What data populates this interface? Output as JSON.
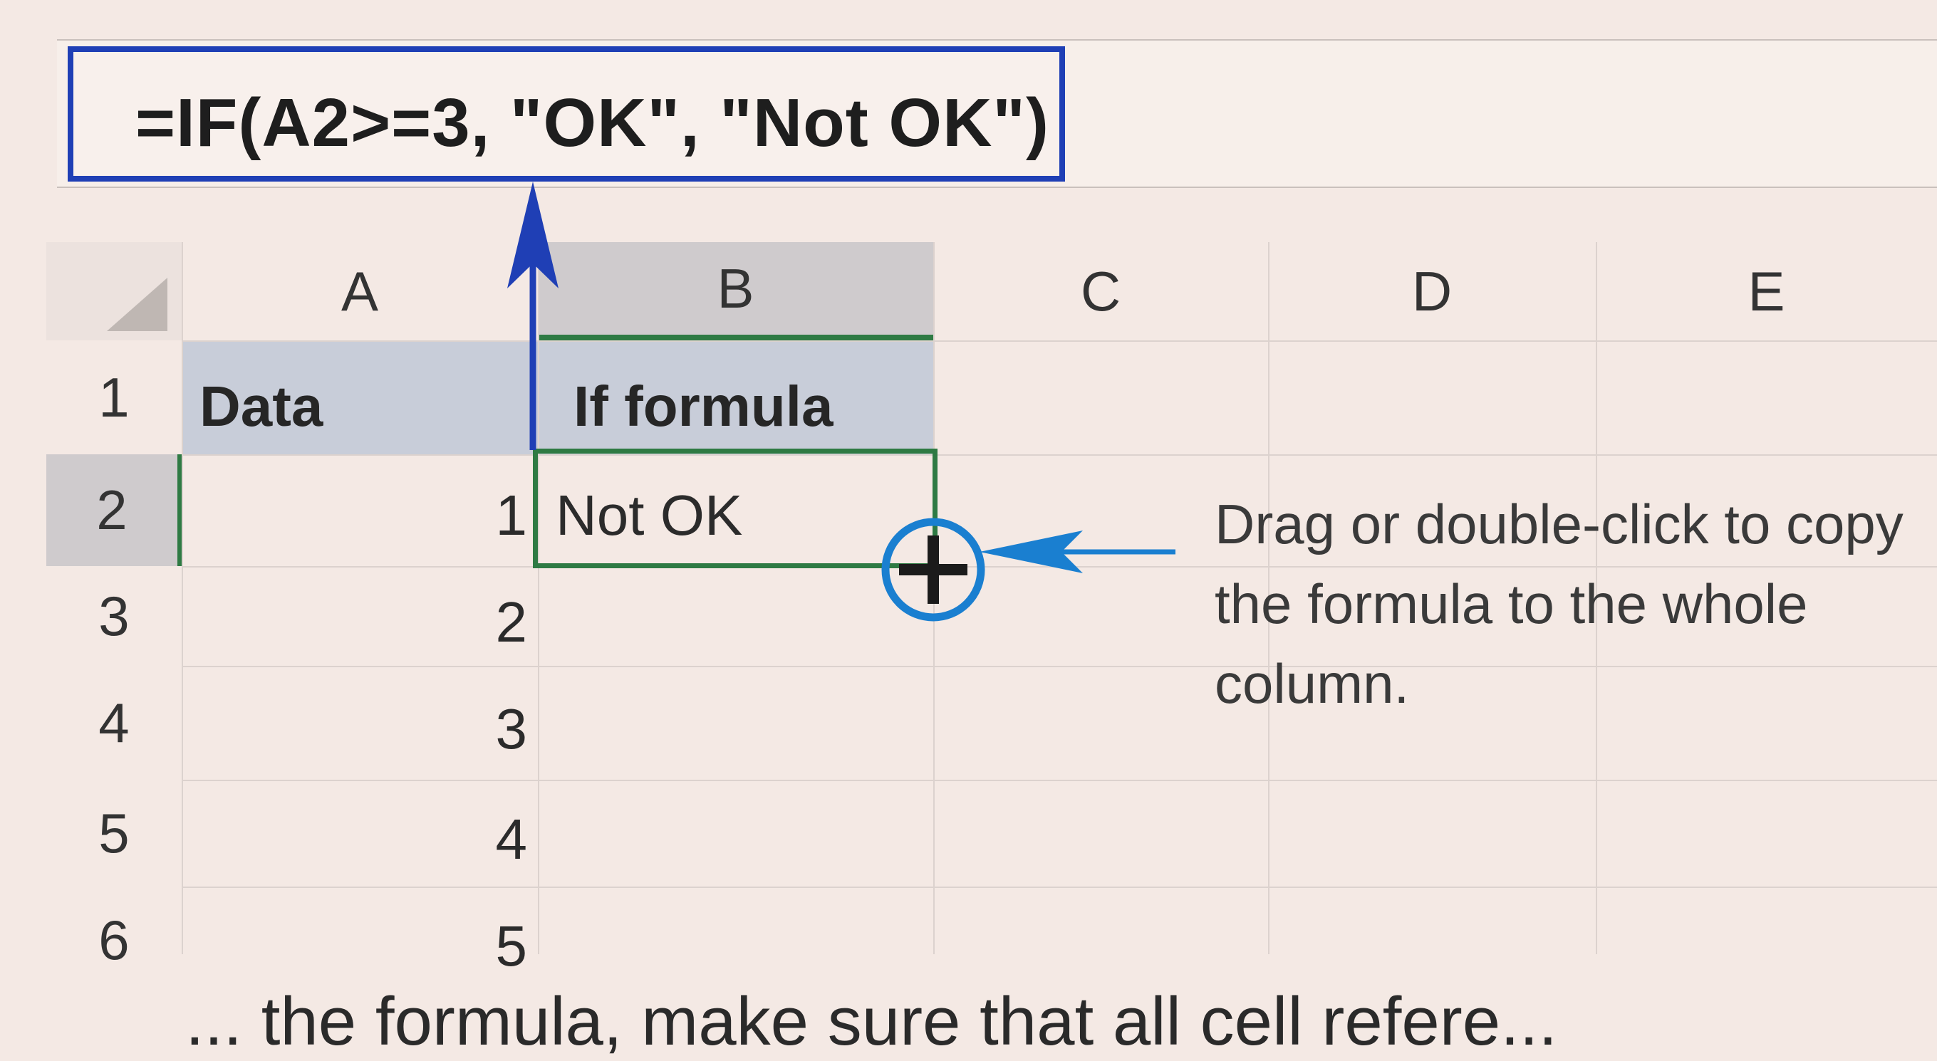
{
  "formula_bar": {
    "formula": "=IF(A2>=3, \"OK\", \"Not OK\")"
  },
  "sheet": {
    "columns": [
      "A",
      "B",
      "C",
      "D",
      "E"
    ],
    "rows": [
      {
        "row_num": "1",
        "a": "Data",
        "b": "If formula"
      },
      {
        "row_num": "2",
        "a": "1",
        "b": "Not OK"
      },
      {
        "row_num": "3",
        "a": "2",
        "b": ""
      },
      {
        "row_num": "4",
        "a": "3",
        "b": ""
      },
      {
        "row_num": "5",
        "a": "4",
        "b": ""
      },
      {
        "row_num": "6",
        "a": "5",
        "b": ""
      }
    ],
    "selected_cell": "B2"
  },
  "annotation": {
    "text": "Drag or double-click to copy the formula to the whole column."
  },
  "footer_text": "... the formula, make sure that all cell refere...",
  "icons": [
    "fill-handle-plus-icon",
    "arrow-up-icon",
    "arrow-left-icon"
  ],
  "colors": {
    "highlight_blue": "#1f3fb5",
    "selection_green": "#2e7a43",
    "arrow_blue": "#1a7fd0"
  }
}
